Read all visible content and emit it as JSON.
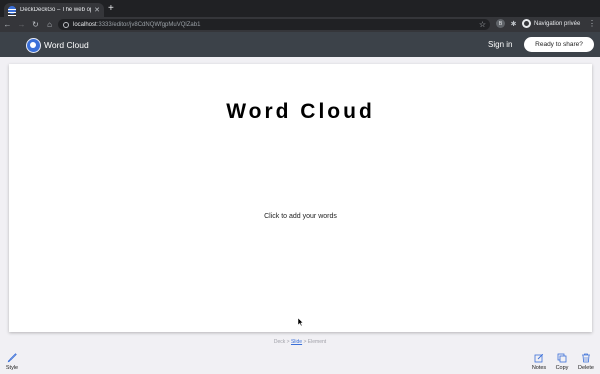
{
  "browser": {
    "tab_title": "DeckDeckGo – The web open",
    "url_host": "localhost",
    "url_path": ":3333/editor/jv8CdNQWfgpMuVQlZab1",
    "profile_label": "Navigation privée",
    "extension_badge": "B"
  },
  "app": {
    "title": "Word Cloud",
    "signin_label": "Sign in",
    "share_label": "Ready to share?"
  },
  "slide": {
    "title": "Word Cloud",
    "hint": "Click to add your words"
  },
  "breadcrumb": {
    "items": [
      "Deck",
      "Slide",
      "Element"
    ],
    "separator": ">",
    "active_index": 1
  },
  "toolbar": {
    "style_label": "Style",
    "notes_label": "Notes",
    "copy_label": "Copy",
    "delete_label": "Delete"
  },
  "colors": {
    "accent": "#3a6fd8",
    "app_bar": "#3c4249",
    "background": "#f1f0f4"
  }
}
